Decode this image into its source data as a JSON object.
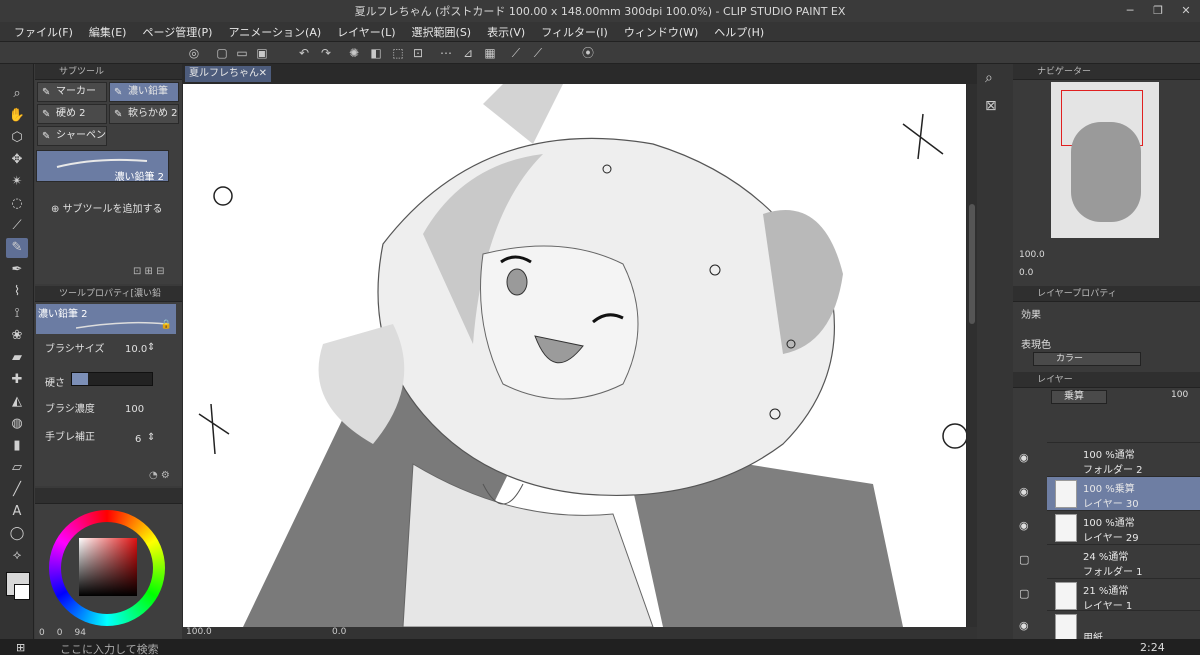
{
  "window": {
    "title": "夏ルフレちゃん (ポストカード 100.00 x 148.00mm 300dpi 100.0%) - CLIP STUDIO PAINT EX"
  },
  "menu": [
    "ファイル(F)",
    "編集(E)",
    "ページ管理(P)",
    "アニメーション(A)",
    "レイヤー(L)",
    "選択範囲(S)",
    "表示(V)",
    "フィルター(I)",
    "ウィンドウ(W)",
    "ヘルプ(H)"
  ],
  "subtool": {
    "panel_title": "サブツール",
    "buttons": [
      "マーカー",
      "濃い鉛筆",
      "硬め 2",
      "軟らかめ 2",
      "シャーペン"
    ],
    "selected_preset": "濃い鉛筆 2",
    "add_label": "サブツールを追加する"
  },
  "toolprop": {
    "panel_title": "ツールプロパティ[濃い鉛",
    "preset": "濃い鉛筆 2",
    "brush_size_label": "ブラシサイズ",
    "brush_size": "10.0",
    "hardness_label": "硬さ",
    "density_label": "ブラシ濃度",
    "density": "100",
    "stabilizer_label": "手ブレ補正",
    "stabilizer": "6"
  },
  "color": {
    "values": [
      "0",
      "0",
      "94"
    ]
  },
  "canvas": {
    "tab_title": "夏ルフレちゃん",
    "zoom": "100.0",
    "angle": "0.0"
  },
  "navigator": {
    "title": "ナビゲーター",
    "zoom": "100.0",
    "angle": "0.0"
  },
  "layer_property": {
    "title": "レイヤープロパティ",
    "effect_label": "効果",
    "expression_label": "表現色",
    "expression_value": "カラー"
  },
  "layers_panel": {
    "title": "レイヤー",
    "blend_mode": "乗算",
    "opacity": "100",
    "items": [
      {
        "line1": "100 %通常",
        "line2": "フォルダー 2"
      },
      {
        "line1": "100 %乗算",
        "line2": "レイヤー 30"
      },
      {
        "line1": "100 %通常",
        "line2": "レイヤー 29"
      },
      {
        "line1": "24 %通常",
        "line2": "フォルダー 1"
      },
      {
        "line1": "21 %通常",
        "line2": "レイヤー 1"
      },
      {
        "line1": "",
        "line2": "用紙"
      }
    ]
  },
  "taskbar": {
    "search": "ここに入力して検索",
    "time": "2:24"
  }
}
